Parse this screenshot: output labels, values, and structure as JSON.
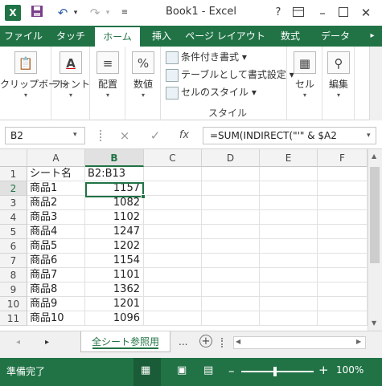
{
  "app": {
    "logo_text": "X",
    "title": "Book1 - Excel"
  },
  "titlebar": {
    "save_icon": "save-icon",
    "undo_icon": "undo-icon",
    "redo_icon": "redo-icon",
    "help": "?"
  },
  "tabs": [
    {
      "label": "ファイル",
      "active": false
    },
    {
      "label": "タッチ",
      "active": false
    },
    {
      "label": "ホーム",
      "active": true
    },
    {
      "label": "挿入",
      "active": false
    },
    {
      "label": "ページ レイアウト",
      "active": false
    },
    {
      "label": "数式",
      "active": false
    },
    {
      "label": "データ",
      "active": false
    }
  ],
  "ribbon": {
    "clipboard": "クリップボード",
    "font": "フォント",
    "align": "配置",
    "number": "数値",
    "percent_symbol": "%",
    "font_symbol": "A",
    "cond_format": "条件付き書式",
    "table_format": "テーブルとして書式設定",
    "cell_style": "セルのスタイル",
    "style_group": "スタイル",
    "cells": "セル",
    "edit": "編集"
  },
  "formula_bar": {
    "name_box": "B2",
    "formula": "=SUM(INDIRECT(\"'\" & $A2",
    "cancel": "×",
    "enter": "✓",
    "fx": "fx"
  },
  "columns": [
    "A",
    "B",
    "C",
    "D",
    "E",
    "F"
  ],
  "selected_column": "B",
  "rows": [
    {
      "n": "1",
      "a": "シート名",
      "b": "B2:B13",
      "b_numeric": false
    },
    {
      "n": "2",
      "a": "商品1",
      "b": "1157",
      "b_numeric": true
    },
    {
      "n": "3",
      "a": "商品2",
      "b": "1082",
      "b_numeric": true
    },
    {
      "n": "4",
      "a": "商品3",
      "b": "1102",
      "b_numeric": true
    },
    {
      "n": "5",
      "a": "商品4",
      "b": "1247",
      "b_numeric": true
    },
    {
      "n": "6",
      "a": "商品5",
      "b": "1202",
      "b_numeric": true
    },
    {
      "n": "7",
      "a": "商品6",
      "b": "1154",
      "b_numeric": true
    },
    {
      "n": "8",
      "a": "商品7",
      "b": "1101",
      "b_numeric": true
    },
    {
      "n": "9",
      "a": "商品8",
      "b": "1362",
      "b_numeric": true
    },
    {
      "n": "10",
      "a": "商品9",
      "b": "1201",
      "b_numeric": true
    },
    {
      "n": "11",
      "a": "商品10",
      "b": "1096",
      "b_numeric": true
    }
  ],
  "sheet_tab": "全シート参照用",
  "sheet_more": "...",
  "status": {
    "text": "準備完了",
    "zoom": "100%"
  },
  "colors": {
    "accent": "#217346",
    "tab_bg": "#217346"
  }
}
